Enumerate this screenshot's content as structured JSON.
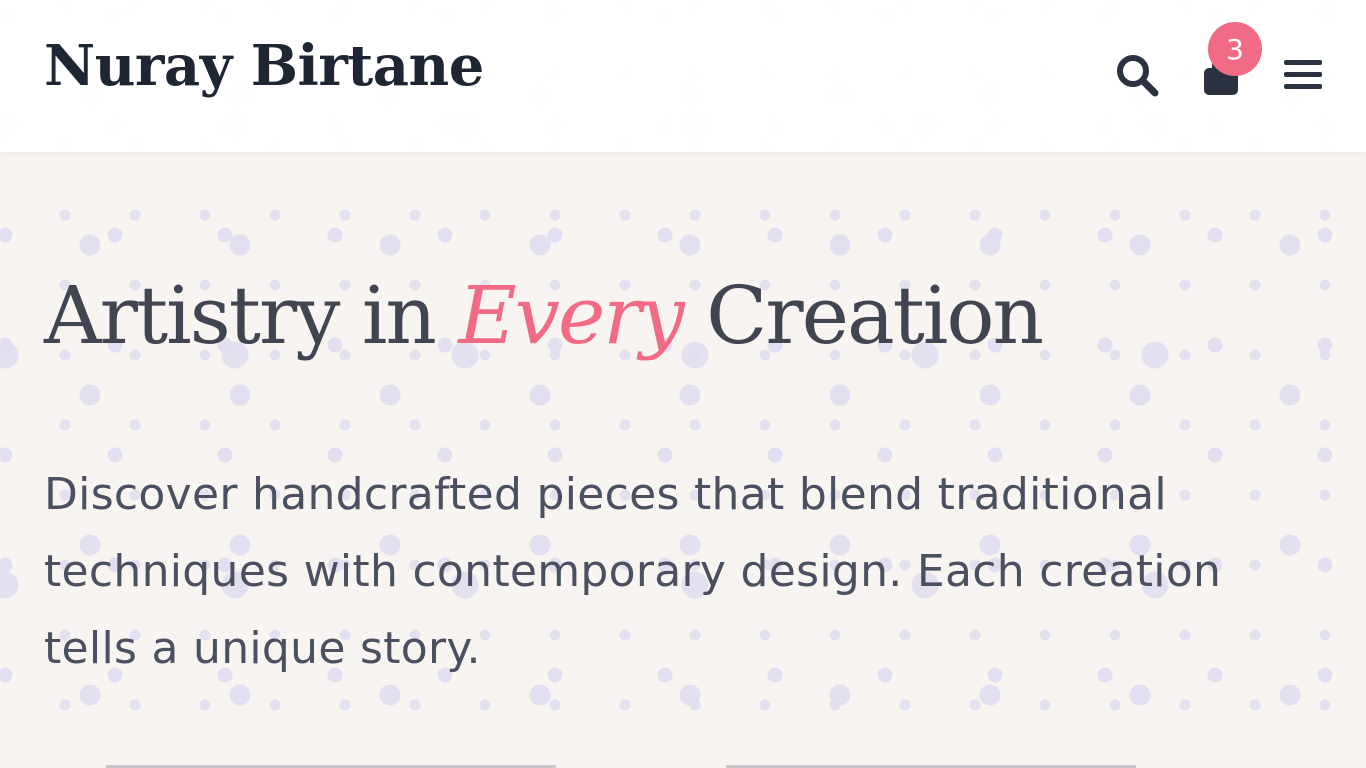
{
  "header": {
    "logo": "Nuray Birtane",
    "cart_count": "3",
    "icons": {
      "search": "search-icon",
      "cart": "shopping-bag-icon",
      "menu": "hamburger-menu-icon"
    }
  },
  "hero": {
    "title_before": "Artistry in ",
    "title_accent": "Every",
    "title_after": " Creation",
    "description": "Discover handcrafted pieces that blend traditional techniques with contemporary design. Each creation tells a unique story."
  },
  "colors": {
    "accent": "#f26b84",
    "text_dark": "#1f2633",
    "background": "#f8f4f2"
  }
}
